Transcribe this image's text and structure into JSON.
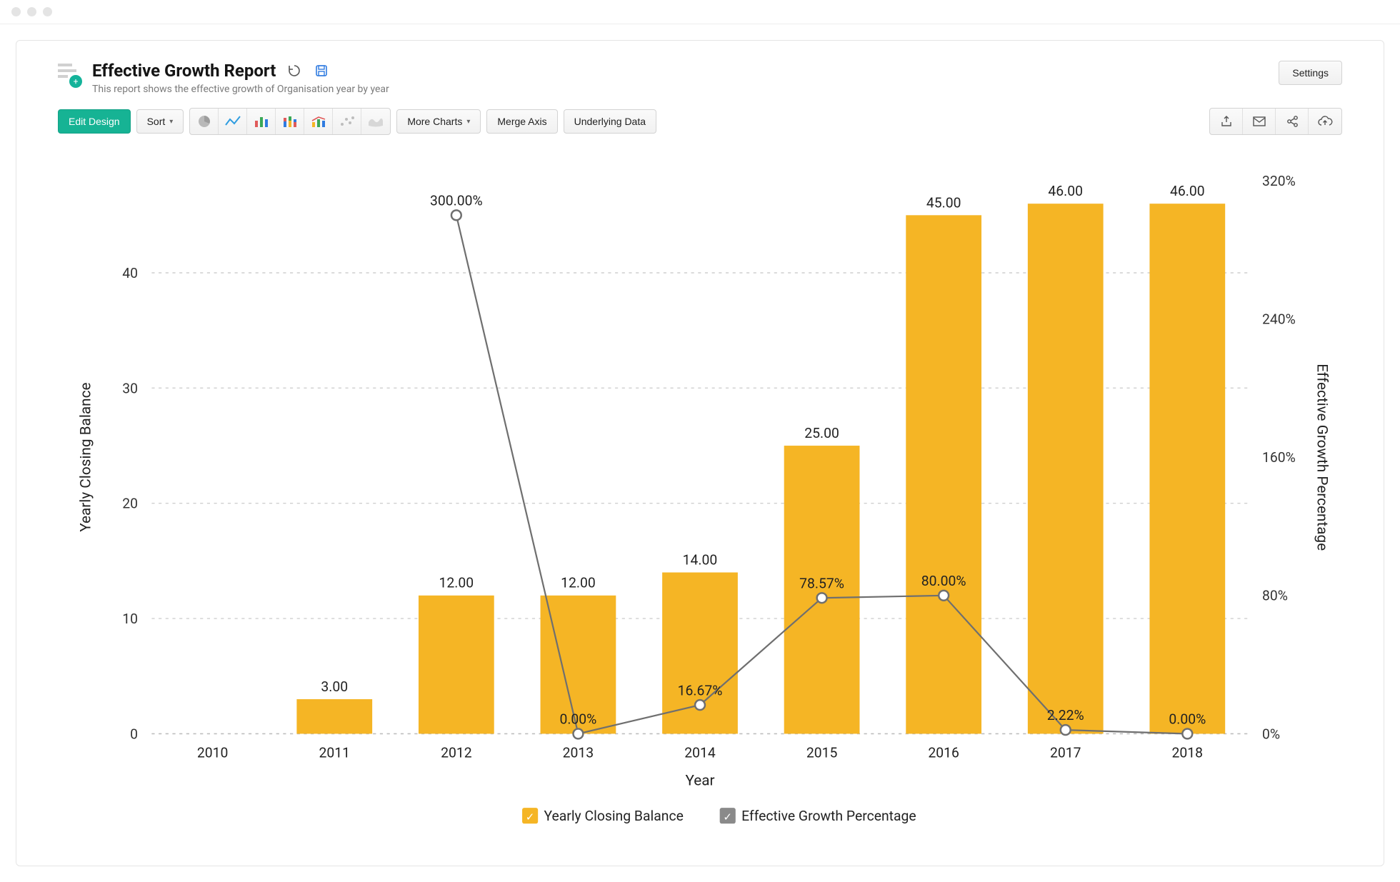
{
  "header": {
    "title": "Effective Growth Report",
    "subtitle": "This report shows the effective growth of Organisation year by year",
    "settings_label": "Settings"
  },
  "toolbar": {
    "edit_design": "Edit Design",
    "sort": "Sort",
    "more_charts": "More Charts",
    "merge_axis": "Merge Axis",
    "underlying_data": "Underlying Data"
  },
  "legend": {
    "series1": "Yearly Closing Balance",
    "series2": "Effective Growth Percentage"
  },
  "axes": {
    "xlabel": "Year",
    "y1label": "Yearly Closing Balance",
    "y2label": "Effective Growth Percentage",
    "y1_ticks": [
      "0",
      "10",
      "20",
      "30",
      "40"
    ],
    "y2_ticks": [
      "0%",
      "80%",
      "160%",
      "240%",
      "320%"
    ]
  },
  "chart_data": {
    "type": "bar",
    "categories": [
      "2010",
      "2011",
      "2012",
      "2013",
      "2014",
      "2015",
      "2016",
      "2017",
      "2018"
    ],
    "xlabel": "Year",
    "y1": {
      "label": "Yearly Closing Balance",
      "ylim": [
        0,
        48
      ],
      "ticks": [
        0,
        10,
        20,
        30,
        40
      ]
    },
    "y2": {
      "label": "Effective Growth Percentage",
      "ylim": [
        0,
        320
      ],
      "ticks": [
        0,
        80,
        160,
        240,
        320
      ]
    },
    "series": [
      {
        "name": "Yearly Closing Balance",
        "type": "bar",
        "axis": "y1",
        "color": "#f5b525",
        "values": [
          null,
          3.0,
          12.0,
          12.0,
          14.0,
          25.0,
          45.0,
          46.0,
          46.0
        ],
        "data_labels": [
          "",
          "3.00",
          "12.00",
          "12.00",
          "14.00",
          "25.00",
          "45.00",
          "46.00",
          "46.00"
        ]
      },
      {
        "name": "Effective Growth Percentage",
        "type": "line",
        "axis": "y2",
        "color": "#6f6f6f",
        "values": [
          null,
          null,
          300.0,
          0.0,
          16.67,
          78.57,
          80.0,
          2.22,
          0.0
        ],
        "data_labels": [
          "",
          "",
          "300.00%",
          "0.00%",
          "16.67%",
          "78.57%",
          "80.00%",
          "2.22%",
          "0.00%"
        ]
      }
    ]
  }
}
